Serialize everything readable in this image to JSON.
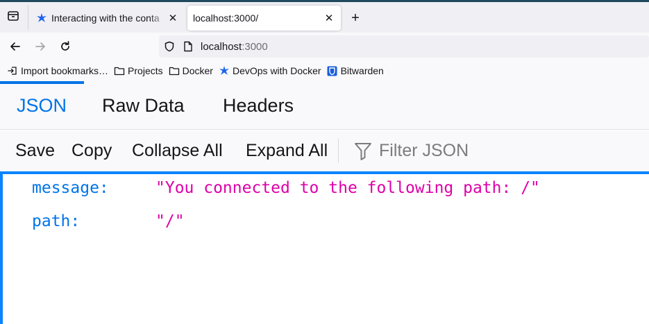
{
  "browser": {
    "tabs": [
      {
        "title": "Interacting with the conta",
        "favicon": "docker-devops-icon",
        "active": false
      },
      {
        "title": "localhost:3000/",
        "favicon": "none",
        "active": true
      }
    ],
    "new_tab_icon": "plus-icon",
    "url": {
      "host": "localhost",
      "port": ":3000"
    },
    "bookmarks": [
      {
        "label": "Import bookmarks…",
        "icon": "import-icon"
      },
      {
        "label": "Projects",
        "icon": "folder-icon"
      },
      {
        "label": "Docker",
        "icon": "folder-icon"
      },
      {
        "label": "DevOps with Docker",
        "icon": "docker-devops-icon"
      },
      {
        "label": "Bitwarden",
        "icon": "bitwarden-icon"
      }
    ]
  },
  "viewer": {
    "tabs": [
      "JSON",
      "Raw Data",
      "Headers"
    ],
    "selected_tab": "JSON",
    "toolbar": {
      "save": "Save",
      "copy": "Copy",
      "collapse_all": "Collapse All",
      "expand_all": "Expand All",
      "filter_placeholder": "Filter JSON"
    },
    "rows": [
      {
        "key": "message:",
        "value": "\"You connected to the following path: /\""
      },
      {
        "key": "path:",
        "value": "\"/\""
      }
    ]
  },
  "colors": {
    "accent": "#0074e8",
    "key": "#0074e8",
    "string": "#dd00a9"
  }
}
